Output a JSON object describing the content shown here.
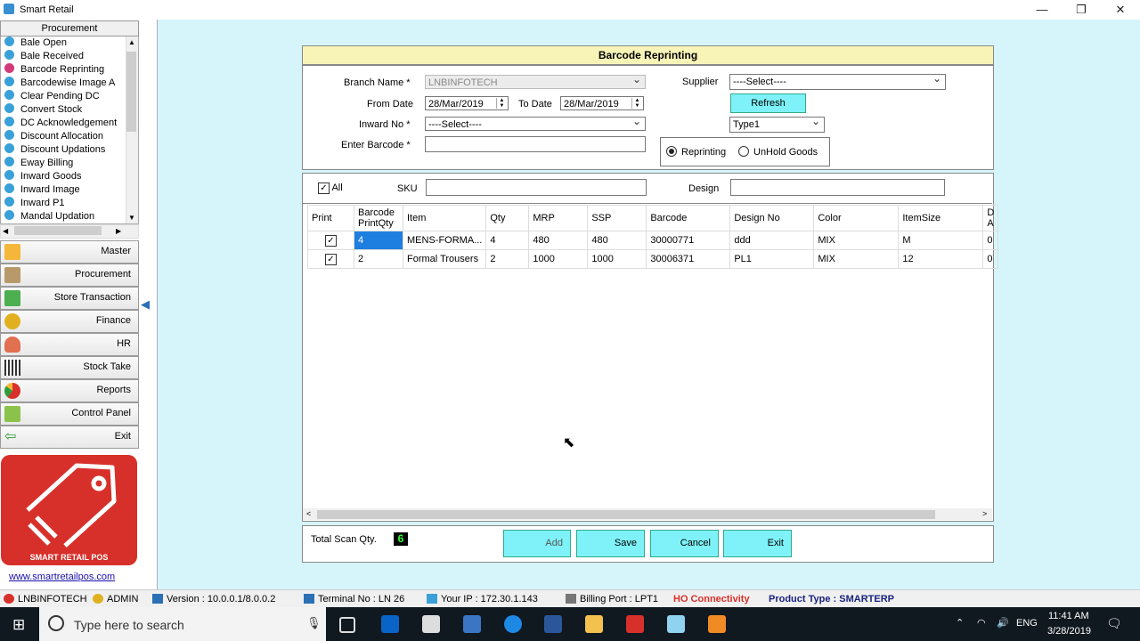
{
  "window": {
    "title": "Smart Retail",
    "minimize": "—",
    "restore": "❐",
    "close": "✕"
  },
  "sidebar": {
    "header": "Procurement",
    "items": [
      {
        "label": "Bale Open"
      },
      {
        "label": "Bale Received"
      },
      {
        "label": "Barcode Reprinting",
        "active": true
      },
      {
        "label": "Barcodewise Image A"
      },
      {
        "label": "Clear Pending DC"
      },
      {
        "label": "Convert Stock"
      },
      {
        "label": "DC Acknowledgement"
      },
      {
        "label": "Discount Allocation"
      },
      {
        "label": "Discount Updations"
      },
      {
        "label": "Eway Billing"
      },
      {
        "label": "Inward Goods"
      },
      {
        "label": "Inward Image"
      },
      {
        "label": "Inward P1"
      },
      {
        "label": "Mandal Updation"
      }
    ],
    "menus": [
      {
        "label": "Master",
        "icon": "folder-icon",
        "color": "#f4b73a"
      },
      {
        "label": "Procurement",
        "icon": "boxes-icon",
        "color": "#b89a6a"
      },
      {
        "label": "Store Transaction",
        "icon": "store-icon",
        "color": "#4caf50"
      },
      {
        "label": "Finance",
        "icon": "coin-icon",
        "color": "#e0b020"
      },
      {
        "label": "HR",
        "icon": "person-icon",
        "color": "#e07050"
      },
      {
        "label": "Stock Take",
        "icon": "barcode-icon",
        "color": "#333333"
      },
      {
        "label": "Reports",
        "icon": "pie-chart-icon",
        "color": "#d8302a"
      },
      {
        "label": "Control Panel",
        "icon": "control-panel-icon",
        "color": "#8bc34a"
      },
      {
        "label": "Exit",
        "icon": "exit-icon",
        "color": "#2e9d3a"
      }
    ],
    "logo_text": "SMART RETAIL POS",
    "website": "www.smartretailpos.com"
  },
  "form": {
    "title": "Barcode Reprinting",
    "branch_label": "Branch Name *",
    "branch_value": "LNBINFOTECH",
    "from_label": "From Date",
    "from_value": "28/Mar/2019",
    "to_label": "To Date",
    "to_value": "28/Mar/2019",
    "inward_label": "Inward No *",
    "inward_value": "----Select----",
    "barcode_label": "Enter Barcode *",
    "barcode_value": "",
    "supplier_label": "Supplier",
    "supplier_value": "----Select----",
    "refresh_label": "Refresh",
    "type_value": "Type1",
    "radio_reprinting": "Reprinting",
    "radio_unhold": "UnHold Goods"
  },
  "filter": {
    "all_label": "All",
    "sku_label": "SKU",
    "design_label": "Design"
  },
  "grid": {
    "headers": [
      "Print",
      "Barcode PrintQty",
      "Item",
      "Qty",
      "MRP",
      "SSP",
      "Barcode",
      "Design No",
      "Color",
      "ItemSize",
      "D A"
    ],
    "rows": [
      {
        "print": true,
        "printqty": "4",
        "item": "MENS-FORMA...",
        "qty": "4",
        "mrp": "480",
        "ssp": "480",
        "barcode": "30000771",
        "design": "ddd",
        "color": "MIX",
        "size": "M",
        "d": "0"
      },
      {
        "print": true,
        "printqty": "2",
        "item": "Formal Trousers",
        "qty": "2",
        "mrp": "1000",
        "ssp": "1000",
        "barcode": "30006371",
        "design": "PL1",
        "color": "MIX",
        "size": "12",
        "d": "0"
      }
    ]
  },
  "footer": {
    "total_label": "Total Scan Qty.",
    "total_value": "6",
    "add": "Add",
    "save": "Save",
    "cancel": "Cancel",
    "exit": "Exit"
  },
  "status": {
    "branch": "LNBINFOTECH",
    "user": "ADMIN",
    "version": "Version : 10.0.0.1/8.0.0.2",
    "terminal": "Terminal No : LN 26",
    "ip": "Your IP : 172.30.1.143",
    "billing": "Billing Port : LPT1",
    "ho": "HO Connectivity",
    "product": "Product Type : SMARTERP"
  },
  "taskbar": {
    "search_placeholder": "Type here to search",
    "time": "11:41 AM",
    "date": "3/28/2019",
    "lang": "ENG"
  }
}
